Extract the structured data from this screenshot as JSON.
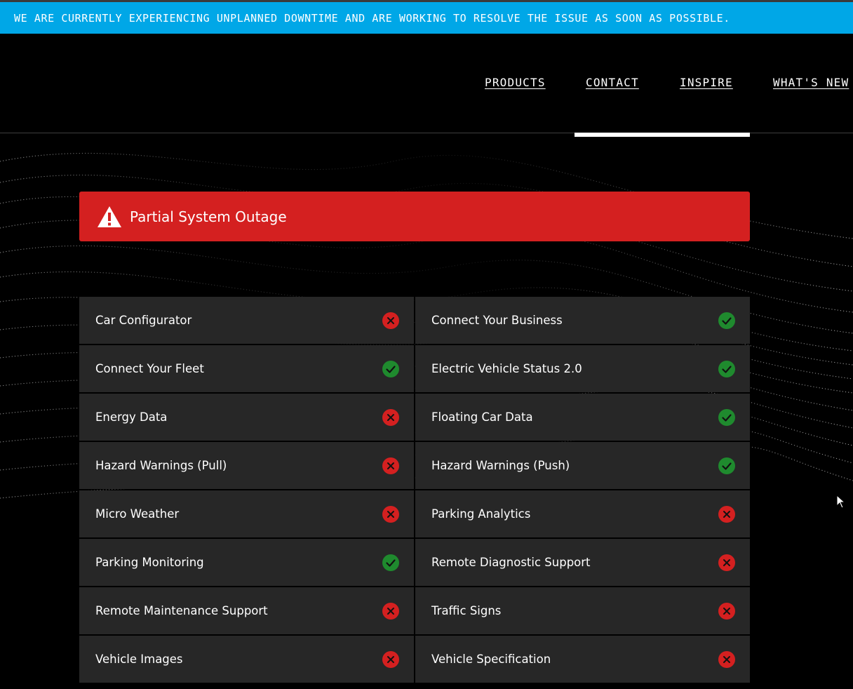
{
  "banner": {
    "text": "WE ARE CURRENTLY EXPERIENCING UNPLANNED DOWNTIME AND ARE WORKING TO RESOLVE THE ISSUE AS SOON AS POSSIBLE."
  },
  "nav": {
    "items": [
      {
        "label": "PRODUCTS"
      },
      {
        "label": "CONTACT"
      },
      {
        "label": "INSPIRE"
      },
      {
        "label": "WHAT'S NEW"
      }
    ]
  },
  "outage": {
    "icon": "warning-triangle-icon",
    "title": "Partial System Outage",
    "color": "#d42020"
  },
  "colors": {
    "banner": "#00a7e7",
    "operational": "#1f8a2e",
    "outage": "#d42020",
    "tile": "#272727"
  },
  "services": [
    {
      "name": "Car Configurator",
      "status": "down"
    },
    {
      "name": "Connect Your Business",
      "status": "up"
    },
    {
      "name": "Connect Your Fleet",
      "status": "up"
    },
    {
      "name": "Electric Vehicle Status 2.0",
      "status": "up"
    },
    {
      "name": "Energy Data",
      "status": "down"
    },
    {
      "name": "Floating Car Data",
      "status": "up"
    },
    {
      "name": "Hazard Warnings (Pull)",
      "status": "down"
    },
    {
      "name": "Hazard Warnings (Push)",
      "status": "up"
    },
    {
      "name": "Micro Weather",
      "status": "down"
    },
    {
      "name": "Parking Analytics",
      "status": "down"
    },
    {
      "name": "Parking Monitoring",
      "status": "up"
    },
    {
      "name": "Remote Diagnostic Support",
      "status": "down"
    },
    {
      "name": "Remote Maintenance Support",
      "status": "down"
    },
    {
      "name": "Traffic Signs",
      "status": "down"
    },
    {
      "name": "Vehicle Images",
      "status": "down"
    },
    {
      "name": "Vehicle Specification",
      "status": "down"
    }
  ]
}
